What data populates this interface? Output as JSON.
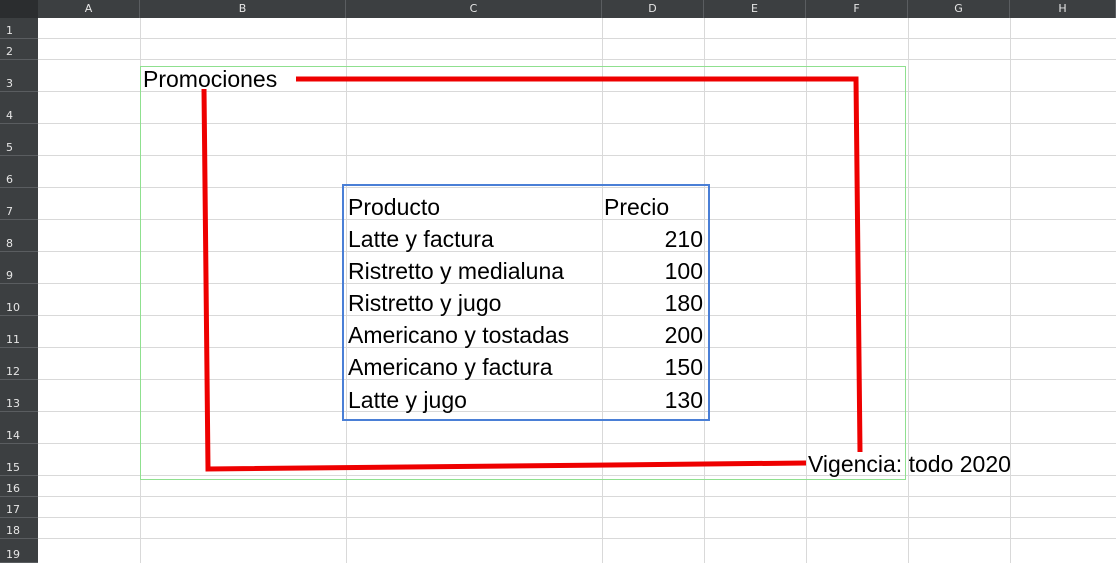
{
  "columns": [
    "A",
    "B",
    "C",
    "D",
    "E",
    "F",
    "G",
    "H"
  ],
  "rows": [
    "1",
    "2",
    "3",
    "4",
    "5",
    "6",
    "7",
    "8",
    "9",
    "10",
    "11",
    "12",
    "13",
    "14",
    "15",
    "16",
    "17",
    "18",
    "19"
  ],
  "cells": {
    "title": "Promociones",
    "footer": "Vigencia: todo 2020",
    "table": {
      "headers": [
        "Producto",
        "Precio"
      ],
      "rows": [
        [
          "Latte y factura",
          "210"
        ],
        [
          "Ristretto y medialuna",
          "100"
        ],
        [
          "Ristretto y jugo",
          "180"
        ],
        [
          "Americano y tostadas",
          "200"
        ],
        [
          "Americano y factura",
          "150"
        ],
        [
          "Latte y jugo",
          "130"
        ]
      ]
    }
  },
  "colors": {
    "header_bg": "#3c3f41",
    "grid_line": "#d9d9d9",
    "annotation_red": "#ee0000",
    "outer_box": "#8fe08f",
    "table_box": "#4a7fd6"
  }
}
